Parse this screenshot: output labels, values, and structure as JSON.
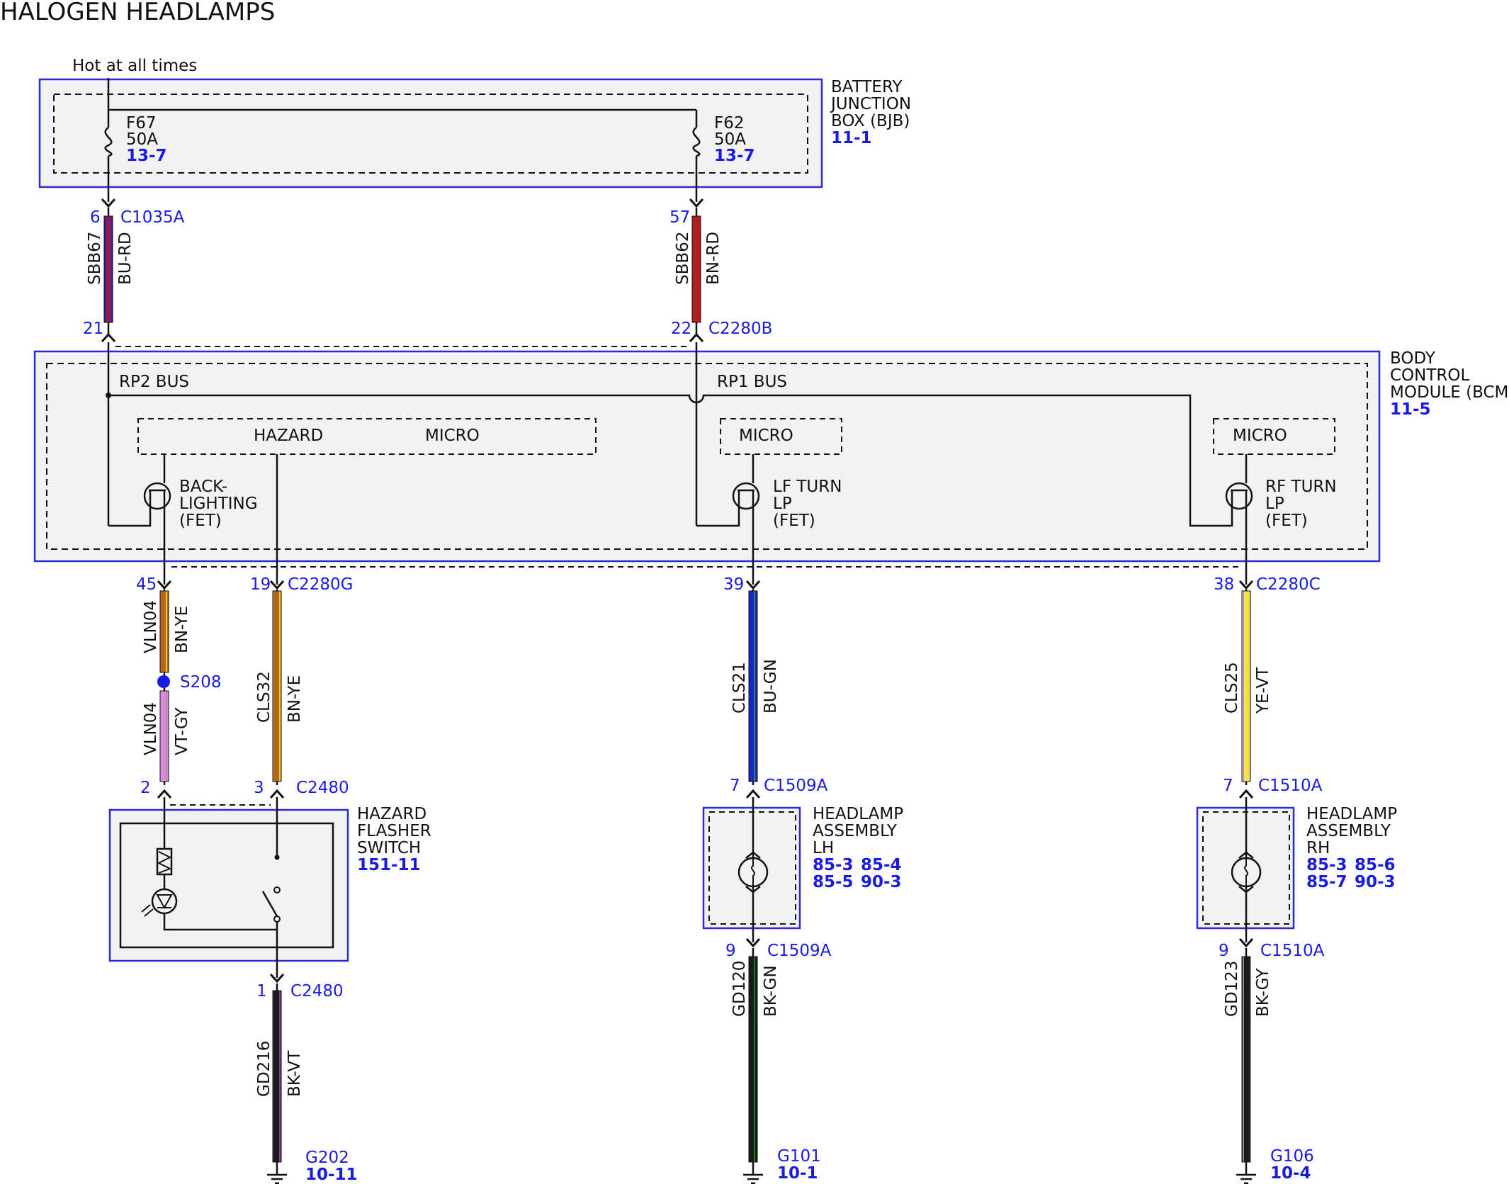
{
  "title": "HALOGEN HEADLAMPS",
  "hot_label": "Hot at all times",
  "bjb": {
    "name_lines": [
      "BATTERY",
      "JUNCTION",
      "BOX (BJB)"
    ],
    "ref": "11-1",
    "fuses": [
      {
        "id": "F67",
        "rating": "50A",
        "ref": "13-7"
      },
      {
        "id": "F62",
        "rating": "50A",
        "ref": "13-7"
      }
    ]
  },
  "bcm": {
    "name_lines": [
      "BODY",
      "CONTROL",
      "MODULE (BCM)"
    ],
    "ref": "11-5",
    "rp2": "RP2 BUS",
    "rp1": "RP1 BUS",
    "hazard": "HAZARD",
    "micro": "MICRO",
    "fets": [
      {
        "lines": [
          "BACK-",
          "LIGHTING",
          "(FET)"
        ]
      },
      {
        "lines": [
          "LF TURN",
          "LP",
          "(FET)"
        ]
      },
      {
        "lines": [
          "RF TURN",
          "LP",
          "(FET)"
        ]
      }
    ]
  },
  "connectors": {
    "c1035a": {
      "pin": "6",
      "name": "C1035A"
    },
    "c2280b_top": {
      "pin": "57"
    },
    "bcm_21": {
      "pin": "21"
    },
    "c2280b": {
      "pin": "22",
      "name": "C2280B"
    },
    "c2280g_45": {
      "pin": "45"
    },
    "c2280g": {
      "pin": "19",
      "name": "C2280G"
    },
    "c2280c_39": {
      "pin": "39"
    },
    "c2280c": {
      "pin": "38",
      "name": "C2280C"
    },
    "c2480_2": {
      "pin": "2"
    },
    "c2480": {
      "pin": "3",
      "name": "C2480"
    },
    "c2480_1": {
      "pin": "1",
      "name": "C2480"
    },
    "c1509a_7": {
      "pin": "7",
      "name": "C1509A"
    },
    "c1509a_9": {
      "pin": "9",
      "name": "C1509A"
    },
    "c1510a_7": {
      "pin": "7",
      "name": "C1510A"
    },
    "c1510a_9": {
      "pin": "9",
      "name": "C1510A"
    }
  },
  "splice": "S208",
  "wires": {
    "sbb67": {
      "circuit": "SBB67",
      "color": "BU-RD"
    },
    "sbb62": {
      "circuit": "SBB62",
      "color": "BN-RD"
    },
    "vln04a": {
      "circuit": "VLN04",
      "color": "BN-YE"
    },
    "vln04b": {
      "circuit": "VLN04",
      "color": "VT-GY"
    },
    "cls32": {
      "circuit": "CLS32",
      "color": "BN-YE"
    },
    "cls21": {
      "circuit": "CLS21",
      "color": "BU-GN"
    },
    "cls25": {
      "circuit": "CLS25",
      "color": "YE-VT"
    },
    "gd216": {
      "circuit": "GD216",
      "color": "BK-VT"
    },
    "gd120": {
      "circuit": "GD120",
      "color": "BK-GN"
    },
    "gd123": {
      "circuit": "GD123",
      "color": "BK-GY"
    }
  },
  "hazard_switch": {
    "name_lines": [
      "HAZARD",
      "FLASHER",
      "SWITCH"
    ],
    "ref": "151-11"
  },
  "headlamp_lh": {
    "name_lines": [
      "HEADLAMP",
      "ASSEMBLY",
      "LH"
    ],
    "refs": [
      "85-3",
      "85-4",
      "85-5",
      "90-3"
    ]
  },
  "headlamp_rh": {
    "name_lines": [
      "HEADLAMP",
      "ASSEMBLY",
      "RH"
    ],
    "refs": [
      "85-3",
      "85-6",
      "85-7",
      "90-3"
    ]
  },
  "grounds": [
    {
      "name": "G202",
      "ref": "10-11"
    },
    {
      "name": "G101",
      "ref": "10-1"
    },
    {
      "name": "G106",
      "ref": "10-4"
    }
  ],
  "colors": {
    "link_blue": "#1a1ae6",
    "box_fill": "#f2f2f2",
    "box_border": "#2a2ad6"
  }
}
